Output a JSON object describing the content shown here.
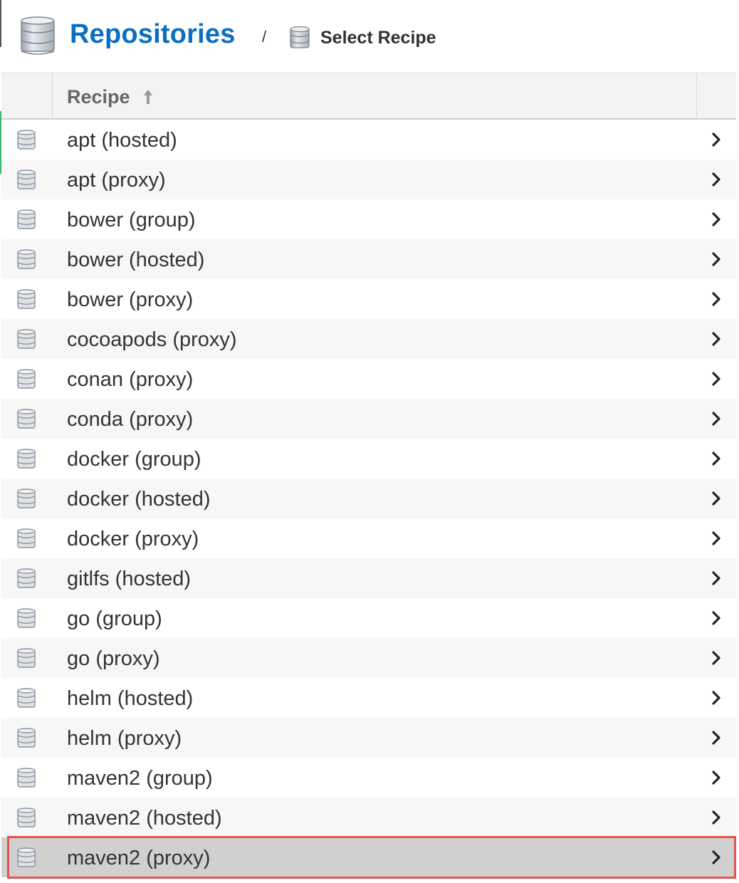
{
  "header": {
    "title": "Repositories",
    "separator": "/",
    "breadcrumb": "Select Recipe",
    "title_color": "#0a6fc2"
  },
  "grid": {
    "column_header": "Recipe",
    "sort": "ascending",
    "rows": [
      {
        "label": "apt (hosted)"
      },
      {
        "label": "apt (proxy)"
      },
      {
        "label": "bower (group)"
      },
      {
        "label": "bower (hosted)"
      },
      {
        "label": "bower (proxy)"
      },
      {
        "label": "cocoapods (proxy)"
      },
      {
        "label": "conan (proxy)"
      },
      {
        "label": "conda (proxy)"
      },
      {
        "label": "docker (group)"
      },
      {
        "label": "docker (hosted)"
      },
      {
        "label": "docker (proxy)"
      },
      {
        "label": "gitlfs (hosted)"
      },
      {
        "label": "go (group)"
      },
      {
        "label": "go (proxy)"
      },
      {
        "label": "helm (hosted)"
      },
      {
        "label": "helm (proxy)"
      },
      {
        "label": "maven2 (group)"
      },
      {
        "label": "maven2 (hosted)"
      },
      {
        "label": "maven2 (proxy)"
      }
    ],
    "selected_row": "maven2 (proxy)",
    "highlight_color": "#e2534c",
    "row_icon": "database-icon",
    "row_action_icon": "chevron-right-icon"
  }
}
